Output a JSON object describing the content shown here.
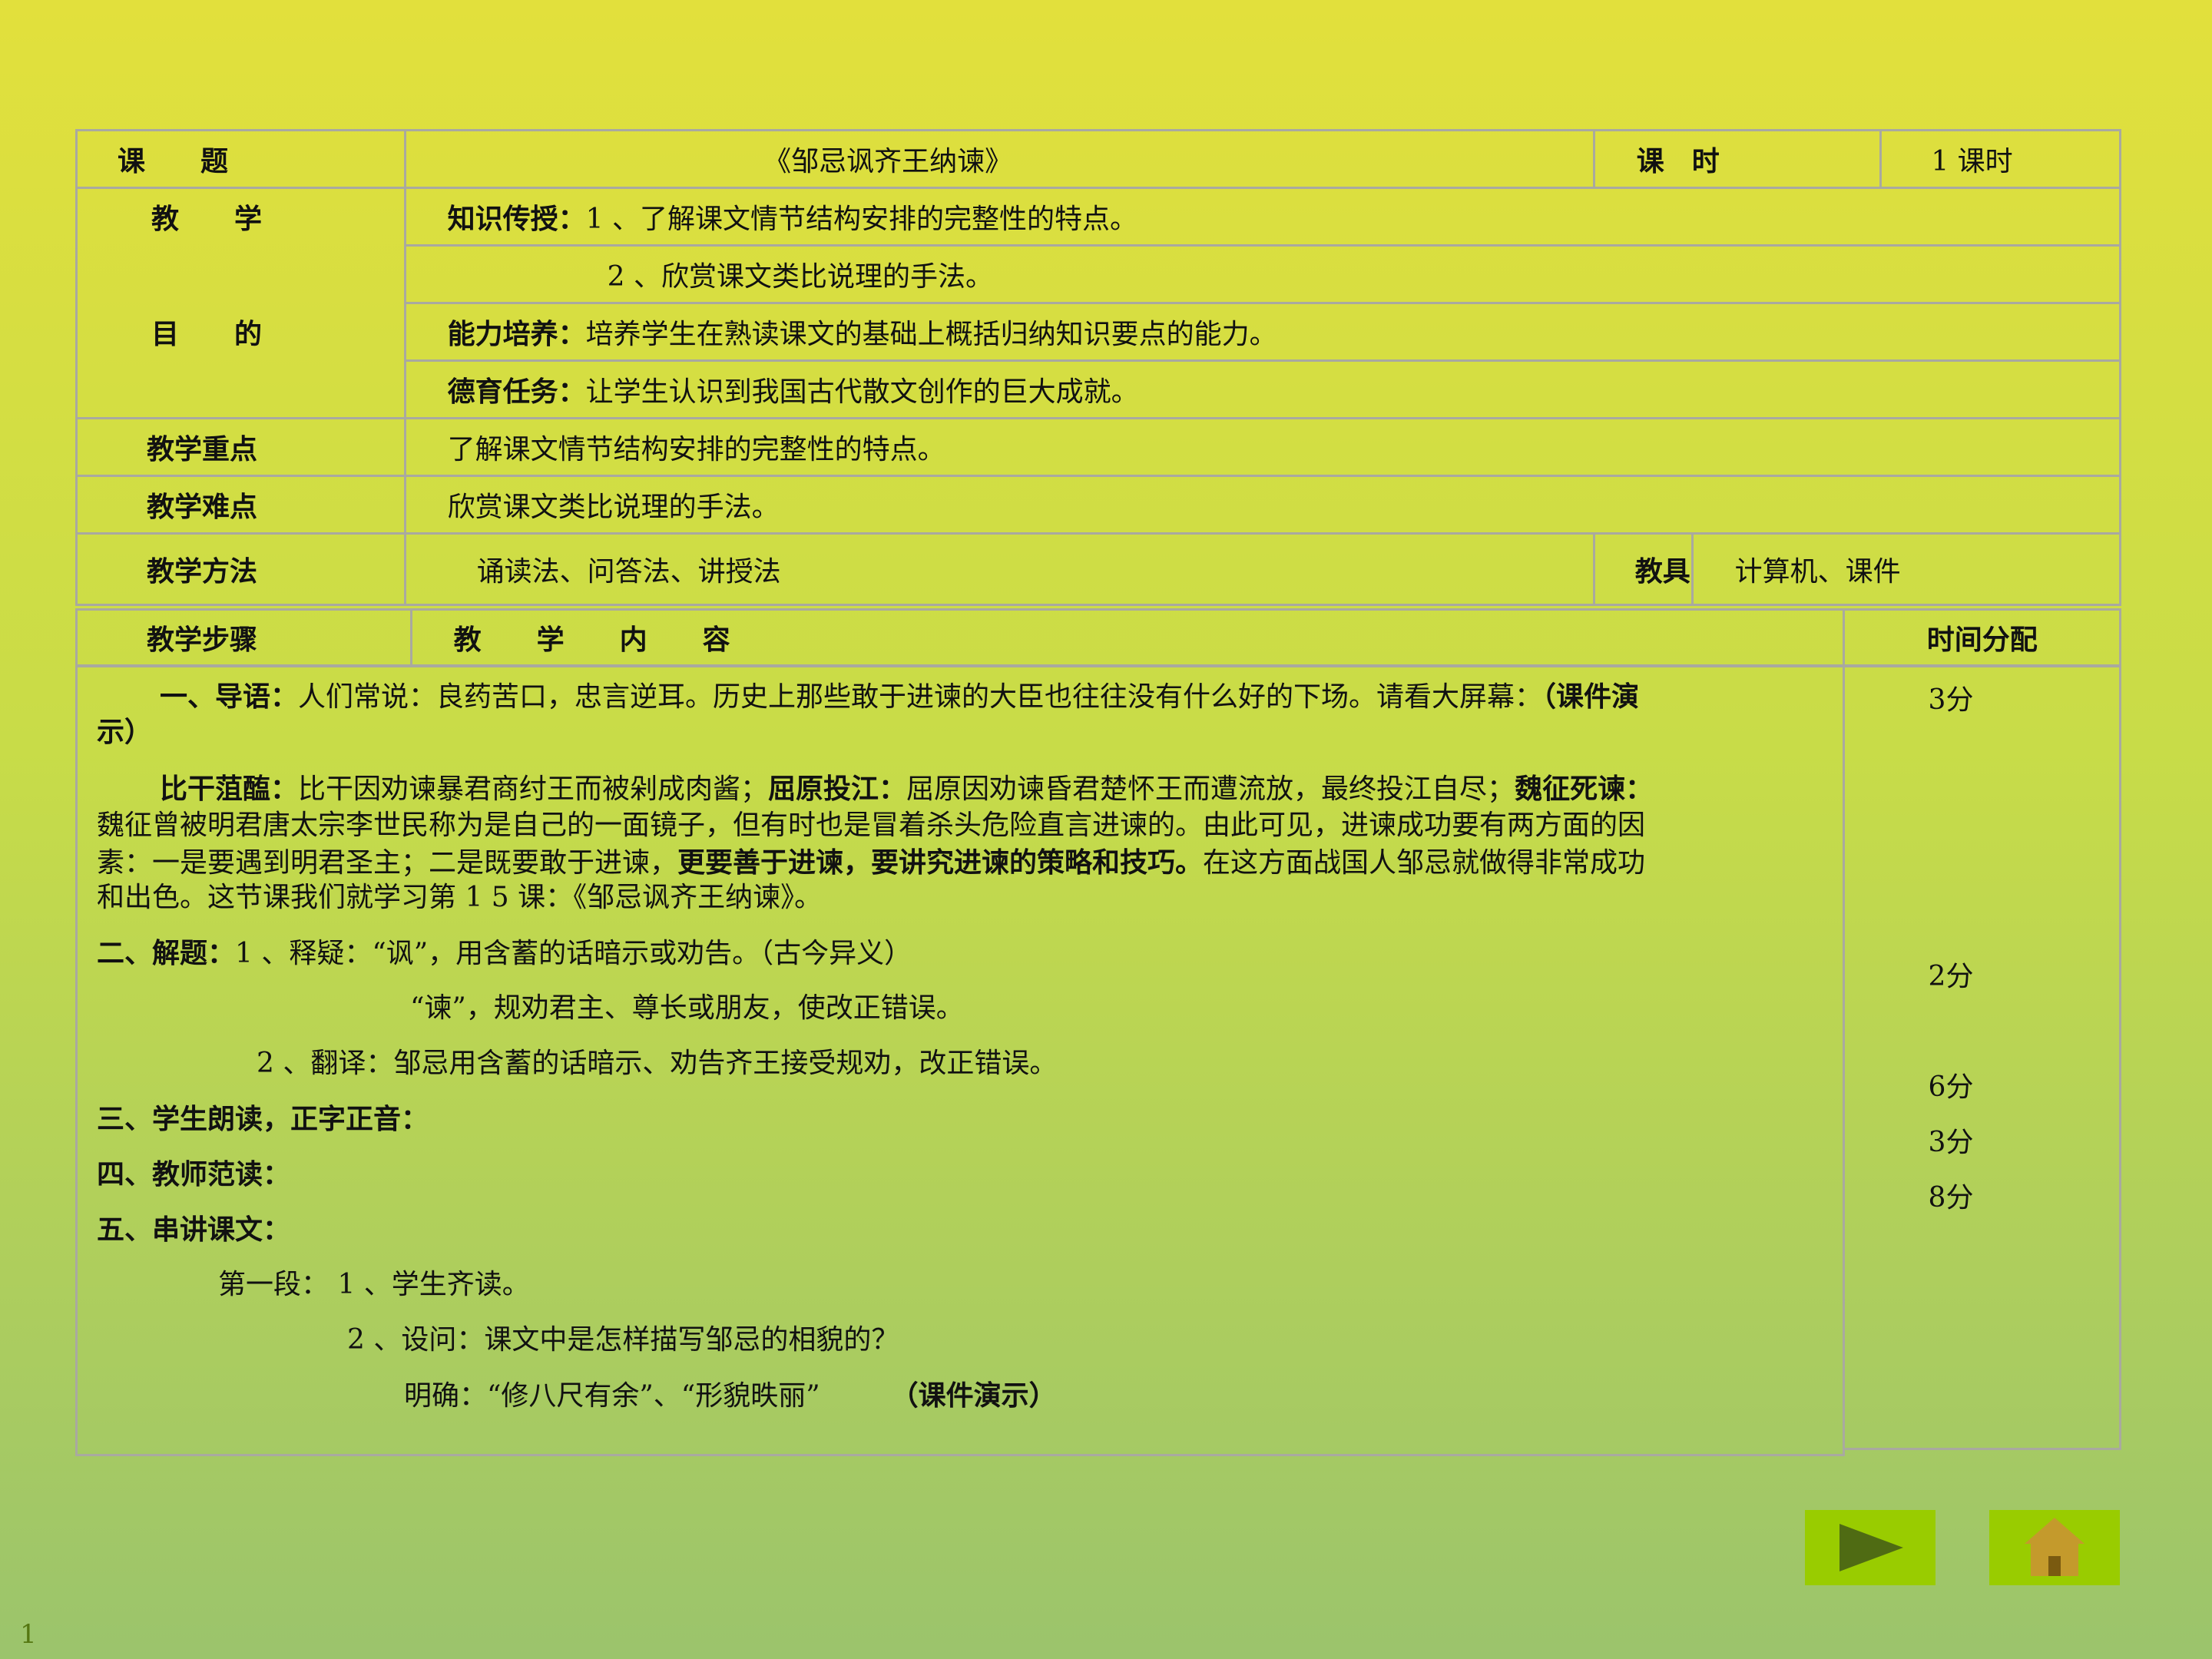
{
  "header": {
    "topic_label": "课　　题",
    "topic_value": "《邹忌讽齐王纳谏》",
    "hours_label": "课　时",
    "hours_value": "1 课时",
    "goal_label_1": "教　　学",
    "goal_label_2": "目　　的",
    "knowledge_label": "知识传授：",
    "knowledge_item1": "1 、了解课文情节结构安排的完整性的特点。",
    "knowledge_item2": "2 、欣赏课文类比说理的手法。",
    "ability_label": "能力培养：",
    "ability_text": "培养学生在熟读课文的基础上概括归纳知识要点的能力。",
    "moral_label": "德育任务：",
    "moral_text": "让学生认识到我国古代散文创作的巨大成就。",
    "key_label": "教学重点",
    "key_text": "了解课文情节结构安排的完整性的特点。",
    "difficulty_label": "教学难点",
    "difficulty_text": "欣赏课文类比说理的手法。",
    "method_label": "教学方法",
    "method_text": "诵读法、问答法、讲授法",
    "tools_label": "教具",
    "tools_text": "计算机、课件"
  },
  "steps_header": {
    "step_label": "教学步骤",
    "content_label": "教　　学　　内　　容",
    "time_label": "时间分配"
  },
  "content": {
    "intro_label": "一、导语：",
    "intro_text": "人们常说：良药苦口，忠言逆耳。历史上那些敢于进谏的大臣也往往没有什么好的下场。请看大屏幕：",
    "intro_demo_a": "（课件演",
    "intro_demo_b": "示）",
    "p2_label1": "比干菹醢：",
    "p2_text1": "比干因劝谏暴君商纣王而被剁成肉酱；",
    "p2_label2": "屈原投江：",
    "p2_text2": "屈原因劝谏昏君楚怀王而遭流放，最终投江自尽；",
    "p2_label3": "魏征死谏：",
    "p2_line2": "魏征曾被明君唐太宗李世民称为是自己的一面镜子，但有时也是冒着杀头危险直言进谏的。由此可见，进谏成功要有两方面的因",
    "p2_line3a": "素：一是要遇到明君圣主；二是既要敢于进谏，",
    "p2_line3b": "更要善于进谏，要讲究进谏的策略和技巧。",
    "p2_line3c": "在这方面战国人邹忌就做得非常成功",
    "p2_line4": "和出色。这节课我们就学习第 1 5 课：《邹忌讽齐王纳谏》。",
    "s2_label": "二、解题：",
    "s2_line1": "1 、释疑：“讽”，用含蓄的话暗示或劝告。（古今异义）",
    "s2_line2": "“谏”，规劝君主、尊长或朋友，使改正错误。",
    "s2_line3": "2 、翻译：邹忌用含蓄的话暗示、劝告齐王接受规劝，改正错误。",
    "s3": "三、学生朗读，正字正音：",
    "s4": "四、教师范读：",
    "s5": "五、串讲课文：",
    "s5_line1": "第一段： 1 、学生齐读。",
    "s5_line2": "2 、设问：课文中是怎样描写邹忌的相貌的？",
    "s5_line3": "明确：“修八尺有余”、“形貌昳丽”",
    "s5_demo": "（课件演示）"
  },
  "times": [
    "3分",
    "2分",
    "6分",
    "3分",
    "8分"
  ],
  "nav": {
    "next_icon": "play-arrow-icon",
    "home_icon": "home-icon",
    "color": "#99cc00"
  },
  "page_number": "1"
}
